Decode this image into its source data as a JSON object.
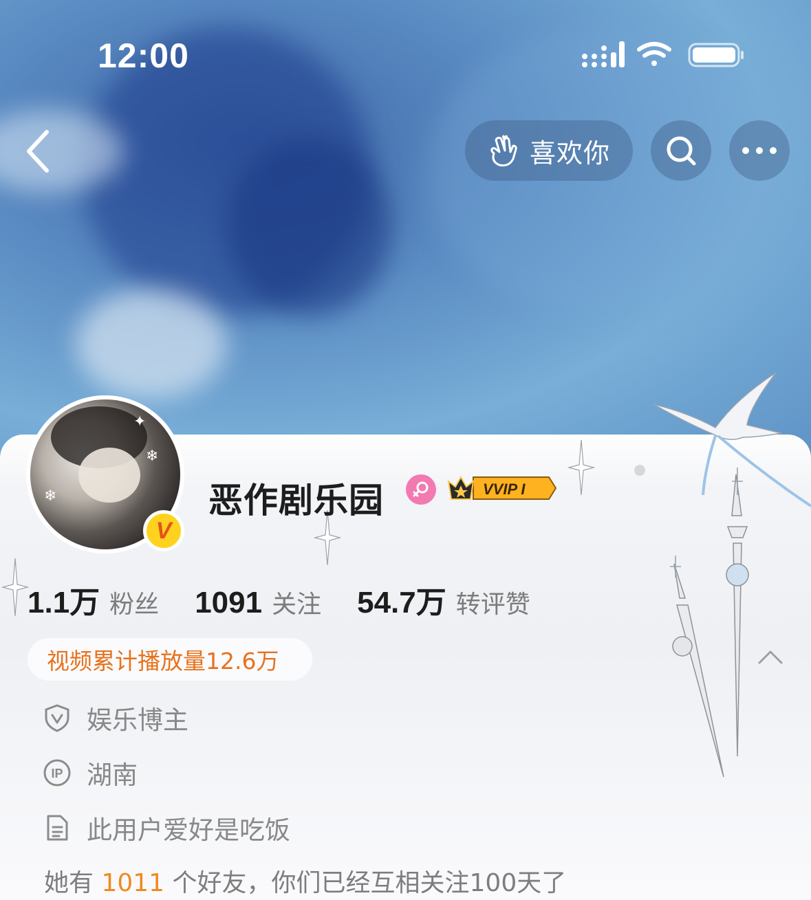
{
  "status_bar": {
    "time": "12:00"
  },
  "header": {
    "like_button_label": "喜欢你"
  },
  "icons": [
    "back-arrow-icon",
    "hand-heart-icon",
    "search-icon",
    "more-icon",
    "verified-v-icon",
    "female-icon",
    "vvip-crown-icon",
    "shield-v-icon",
    "ip-icon",
    "document-icon",
    "chevron-up-icon"
  ],
  "profile": {
    "name": "恶作剧乐园",
    "vip_badge": "VVIP I",
    "v_mark": "V",
    "stats": [
      {
        "value": "1.1万",
        "label": "粉丝"
      },
      {
        "value": "1091",
        "label": "关注"
      },
      {
        "value": "54.7万",
        "label": "转评赞"
      }
    ],
    "play_count": "视频累计播放量12.6万",
    "info": [
      {
        "text": "娱乐博主"
      },
      {
        "text": "湖南"
      },
      {
        "text": "此用户爱好是吃饭"
      }
    ],
    "friends": {
      "prefix": "她有 ",
      "count": "1011",
      "suffix": " 个好友，你们已经互相关注100天了"
    }
  },
  "colors": {
    "accent_orange": "#e7721d",
    "friend_count": "#ef8a1f",
    "female_badge": "#f27ab0",
    "v_badge": "#ffd21f"
  }
}
